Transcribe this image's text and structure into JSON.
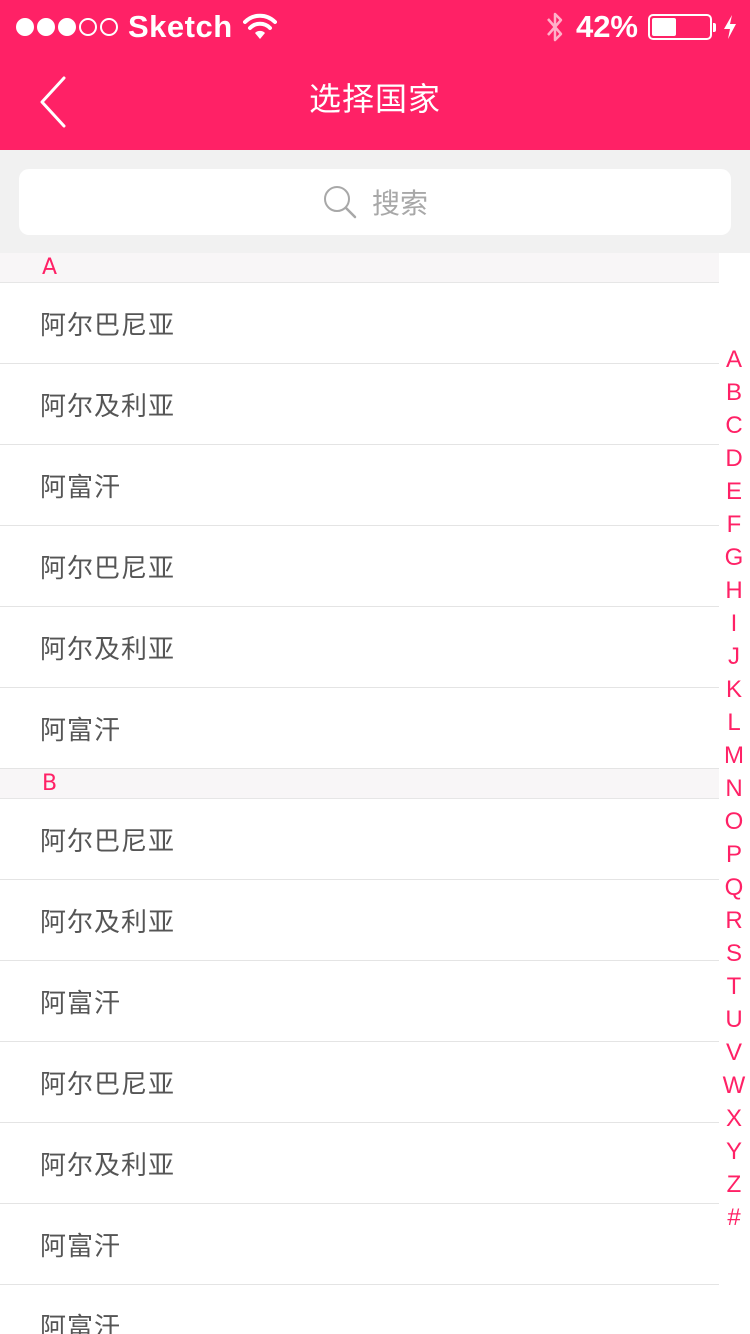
{
  "status_bar": {
    "signal_filled": 3,
    "signal_total": 5,
    "carrier": "Sketch",
    "battery_percent": "42%",
    "battery_level": 0.42
  },
  "nav": {
    "title": "选择国家",
    "back_icon": "chevron-left-icon"
  },
  "search": {
    "placeholder": "搜索",
    "icon": "search-icon"
  },
  "sections": [
    {
      "letter": "A",
      "items": [
        "阿尔巴尼亚",
        "阿尔及利亚",
        "阿富汗",
        "阿尔巴尼亚",
        "阿尔及利亚",
        "阿富汗"
      ]
    },
    {
      "letter": "B",
      "items": [
        "阿尔巴尼亚",
        "阿尔及利亚",
        "阿富汗",
        "阿尔巴尼亚",
        "阿尔及利亚",
        "阿富汗",
        "阿富汗"
      ]
    }
  ],
  "index_letters": [
    "A",
    "B",
    "C",
    "D",
    "E",
    "F",
    "G",
    "H",
    "I",
    "J",
    "K",
    "L",
    "M",
    "N",
    "O",
    "P",
    "Q",
    "R",
    "S",
    "T",
    "U",
    "V",
    "W",
    "X",
    "Y",
    "Z",
    "#"
  ],
  "colors": {
    "accent": "#ff2166",
    "search_bg": "#f1f1f1",
    "section_bg": "#f8f6f7",
    "row_text": "#555555"
  }
}
